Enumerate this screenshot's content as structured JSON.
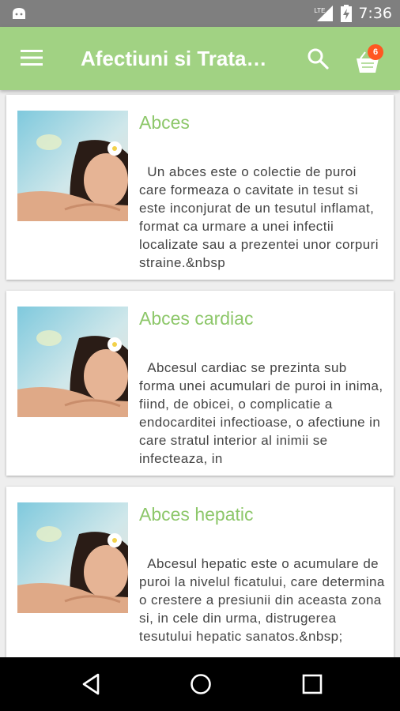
{
  "status_bar": {
    "network": "LTE",
    "time": "7:36"
  },
  "app_bar": {
    "title": "Afectiuni si Tratamente",
    "menu_icon": "hamburger-menu-icon",
    "search_icon": "search-icon",
    "cart_icon": "basket-icon",
    "cart_count": "6"
  },
  "colors": {
    "primary": "#a1d283",
    "title_green": "#8dc76a",
    "badge": "#ff5722"
  },
  "items": [
    {
      "title": "Abces",
      "description": "  Un abces este o colectie de puroi care formeaza o cavitate in tesut si este inconjurat de un tesutul inflamat, format ca urmare a unei infectii localizate sau a prezentei unor corpuri straine.&nbsp"
    },
    {
      "title": "Abces cardiac",
      "description": "  Abcesul cardiac se prezinta sub forma unei acumulari de puroi in inima, fiind, de obicei, o complicatie a endocarditei infectioase, o afectiune in care stratul interior al inimii se infecteaza, in"
    },
    {
      "title": "Abces hepatic",
      "description": "  Abcesul hepatic este o acumulare de puroi la nivelul ficatului, care determina o crestere a presiunii din aceasta zona si, in cele din urma, distrugerea tesutului hepatic sanatos.&nbsp;"
    }
  ]
}
